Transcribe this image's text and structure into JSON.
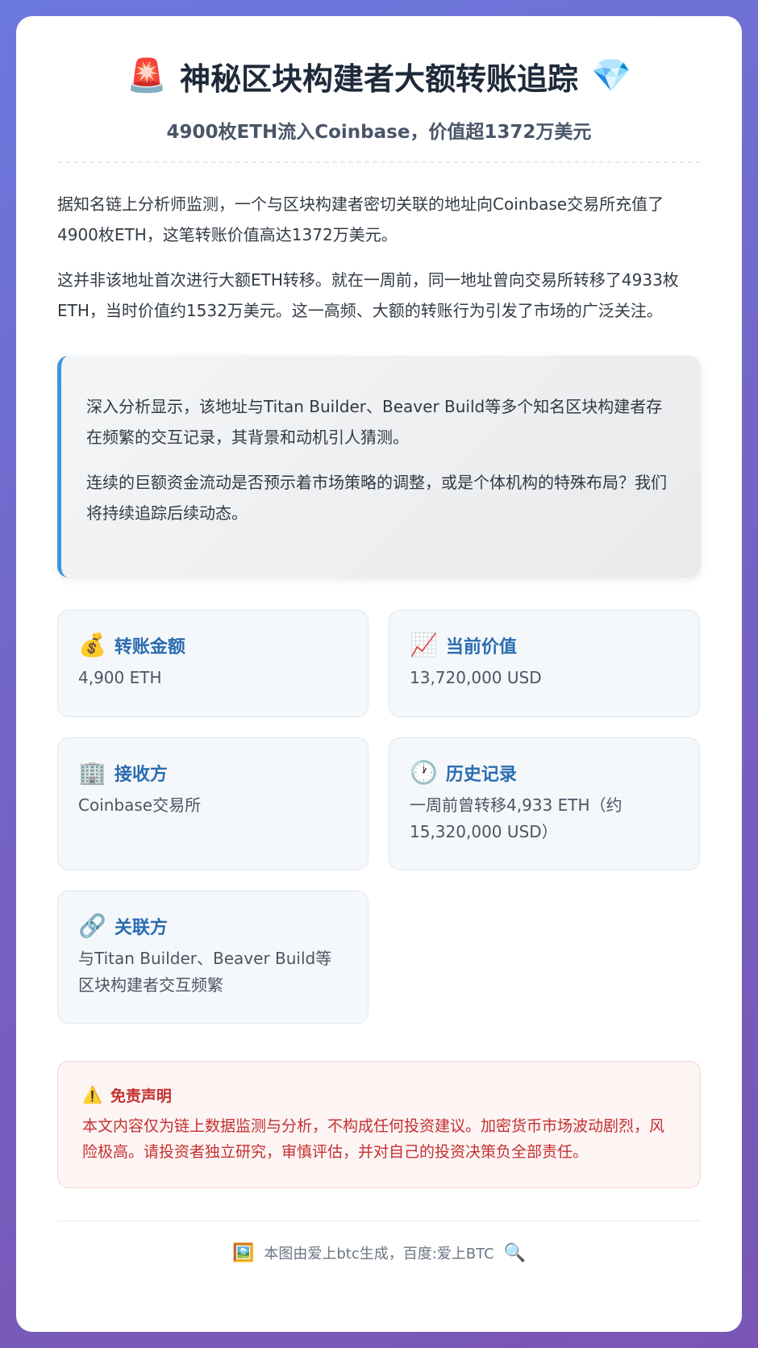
{
  "header": {
    "title_icon_left": "🚨",
    "title": "神秘区块构建者大额转账追踪",
    "title_icon_right": "💎",
    "subtitle": "4900枚ETH流入Coinbase，价值超1372万美元"
  },
  "intro": {
    "p1": "据知名链上分析师监测，一个与区块构建者密切关联的地址向Coinbase交易所充值了4900枚ETH，这笔转账价值高达1372万美元。",
    "p2": "这并非该地址首次进行大额ETH转移。就在一周前，同一地址曾向交易所转移了4933枚ETH，当时价值约1532万美元。这一高频、大额的转账行为引发了市场的广泛关注。"
  },
  "quote": {
    "p1": "深入分析显示，该地址与Titan Builder、Beaver Build等多个知名区块构建者存在频繁的交互记录，其背景和动机引人猜测。",
    "p2": "连续的巨额资金流动是否预示着市场策略的调整，或是个体机构的特殊布局？我们将持续追踪后续动态。"
  },
  "cards": [
    {
      "icon": "💰",
      "label": "转账金额",
      "value": "4,900 ETH"
    },
    {
      "icon": "📈",
      "label": "当前价值",
      "value": "13,720,000 USD"
    },
    {
      "icon": "🏢",
      "label": "接收方",
      "value": "Coinbase交易所"
    },
    {
      "icon": "🕐",
      "label": "历史记录",
      "value": "一周前曾转移4,933 ETH（约15,320,000 USD）"
    },
    {
      "icon": "🔗",
      "label": "关联方",
      "value": "与Titan Builder、Beaver Build等区块构建者交互频繁"
    }
  ],
  "disclaimer": {
    "icon": "⚠️",
    "title": "免责声明",
    "text": "本文内容仅为链上数据监测与分析，不构成任何投资建议。加密货币市场波动剧烈，风险极高。请投资者独立研究，审慎评估，并对自己的投资决策负全部责任。"
  },
  "footer": {
    "icon_left": "🖼️",
    "text": "本图由爱上btc生成，百度:爱上BTC",
    "icon_right": "🔍"
  },
  "colors": {
    "accent": "#2b6cb0",
    "quote_border": "#3b95e0",
    "danger": "#c53030"
  }
}
